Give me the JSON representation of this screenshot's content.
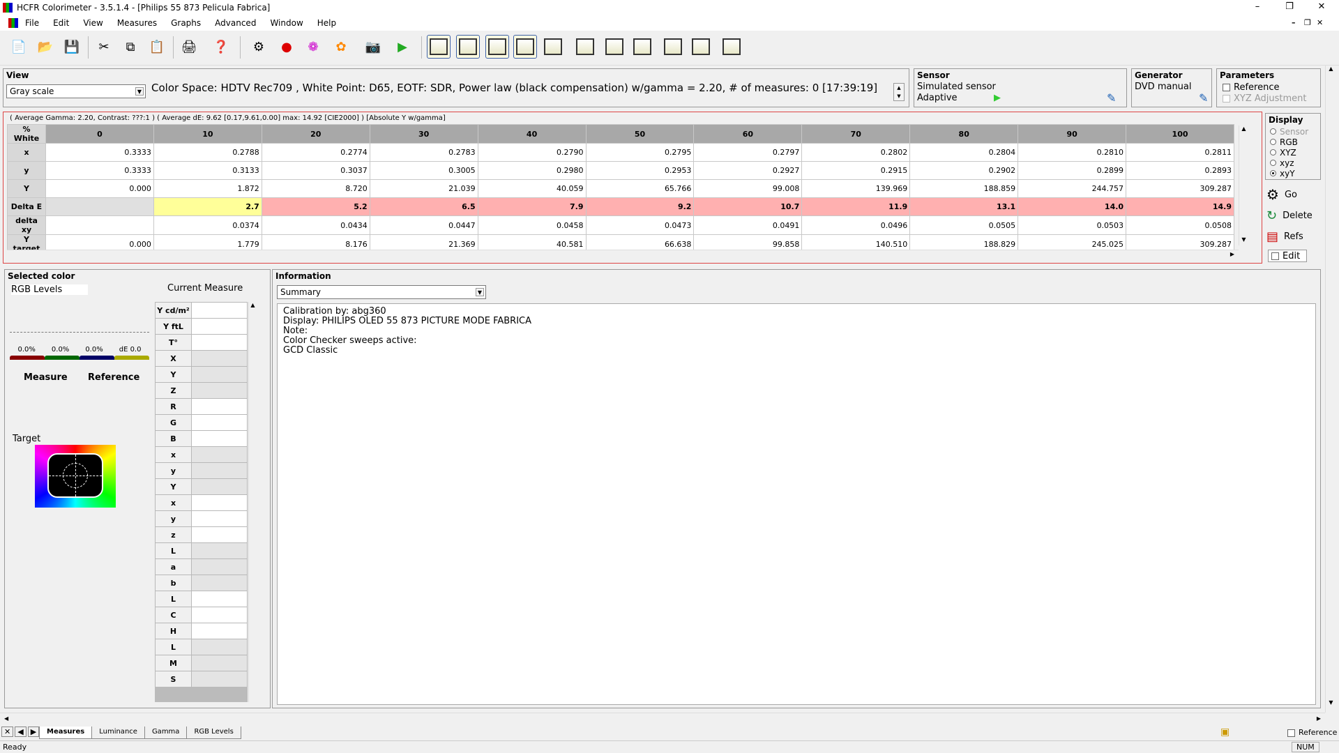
{
  "window": {
    "title": "HCFR Colorimeter - 3.5.1.4 - [Philips 55 873 Pelicula Fabrica]"
  },
  "menu": [
    "File",
    "Edit",
    "View",
    "Measures",
    "Graphs",
    "Advanced",
    "Window",
    "Help"
  ],
  "view_panel": {
    "heading": "View",
    "mode": "Gray scale",
    "info": "Color Space: HDTV Rec709 , White Point: D65, EOTF:  SDR, Power law (black compensation) w/gamma = 2.20, # of measures: 0 [17:39:19]"
  },
  "sensor_panel": {
    "heading": "Sensor",
    "name": "Simulated sensor",
    "mode": "Adaptive"
  },
  "generator_panel": {
    "heading": "Generator",
    "name": "DVD manual"
  },
  "parameters_panel": {
    "heading": "Parameters",
    "reference": "Reference",
    "xyz_adjust": "XYZ Adjustment"
  },
  "summary_line": "( Average Gamma: 2.20, Contrast: ???:1 ) ( Average dE: 9.62 [0.17,9.61,0.00] max: 14.92 [CIE2000] ) [Absolute Y w/gamma]",
  "grid": {
    "columns": [
      "% White",
      "0",
      "10",
      "20",
      "30",
      "40",
      "50",
      "60",
      "70",
      "80",
      "90",
      "100"
    ],
    "rows": [
      {
        "label": "x",
        "cells": [
          "0.3333",
          "0.2788",
          "0.2774",
          "0.2783",
          "0.2790",
          "0.2795",
          "0.2797",
          "0.2802",
          "0.2804",
          "0.2810",
          "0.2811"
        ]
      },
      {
        "label": "y",
        "cells": [
          "0.3333",
          "0.3133",
          "0.3037",
          "0.3005",
          "0.2980",
          "0.2953",
          "0.2927",
          "0.2915",
          "0.2902",
          "0.2899",
          "0.2893"
        ]
      },
      {
        "label": "Y",
        "cells": [
          "0.000",
          "1.872",
          "8.720",
          "21.039",
          "40.059",
          "65.766",
          "99.008",
          "139.969",
          "188.859",
          "244.757",
          "309.287"
        ]
      },
      {
        "label": "Delta E",
        "cells": [
          "",
          "2.7",
          "5.2",
          "6.5",
          "7.9",
          "9.2",
          "10.7",
          "11.9",
          "13.1",
          "14.0",
          "14.9"
        ]
      },
      {
        "label": "delta xy",
        "cells": [
          "",
          "0.0374",
          "0.0434",
          "0.0447",
          "0.0458",
          "0.0473",
          "0.0491",
          "0.0496",
          "0.0505",
          "0.0503",
          "0.0508"
        ]
      },
      {
        "label": "Y target",
        "cells": [
          "0.000",
          "1.779",
          "8.176",
          "21.369",
          "40.581",
          "66.638",
          "99.858",
          "140.510",
          "188.829",
          "245.025",
          "309.287"
        ]
      }
    ]
  },
  "display_panel": {
    "heading": "Display",
    "options": [
      "Sensor",
      "RGB",
      "XYZ",
      "xyz",
      "xyY"
    ],
    "selected": "xyY",
    "go": "Go",
    "delete": "Delete",
    "refs": "Refs",
    "edit": "Edit"
  },
  "selected_color": {
    "heading": "Selected color",
    "rgb_levels": "RGB Levels",
    "current_measure": "Current Measure",
    "bars": [
      "0.0%",
      "0.0%",
      "0.0%",
      "dE 0.0"
    ],
    "measure": "Measure",
    "reference": "Reference",
    "target": "Target",
    "rows": [
      "Y cd/m²",
      "Y ftL",
      "T°",
      "X",
      "Y",
      "Z",
      "R",
      "G",
      "B",
      "x",
      "y",
      "Y",
      "x",
      "y",
      "z",
      "L",
      "a",
      "b",
      "L",
      "C",
      "H",
      "L",
      "M",
      "S"
    ]
  },
  "information": {
    "heading": "Information",
    "mode": "Summary",
    "lines": [
      "Calibration by: abg360",
      "Display: PHILIPS OLED 55 873 PICTURE MODE FABRICA",
      "Note:",
      "Color Checker sweeps active:",
      "GCD Classic"
    ]
  },
  "tabs": [
    "Measures",
    "Luminance",
    "Gamma",
    "RGB Levels"
  ],
  "status": {
    "left": "Ready",
    "num": "NUM",
    "reference": "Reference"
  }
}
